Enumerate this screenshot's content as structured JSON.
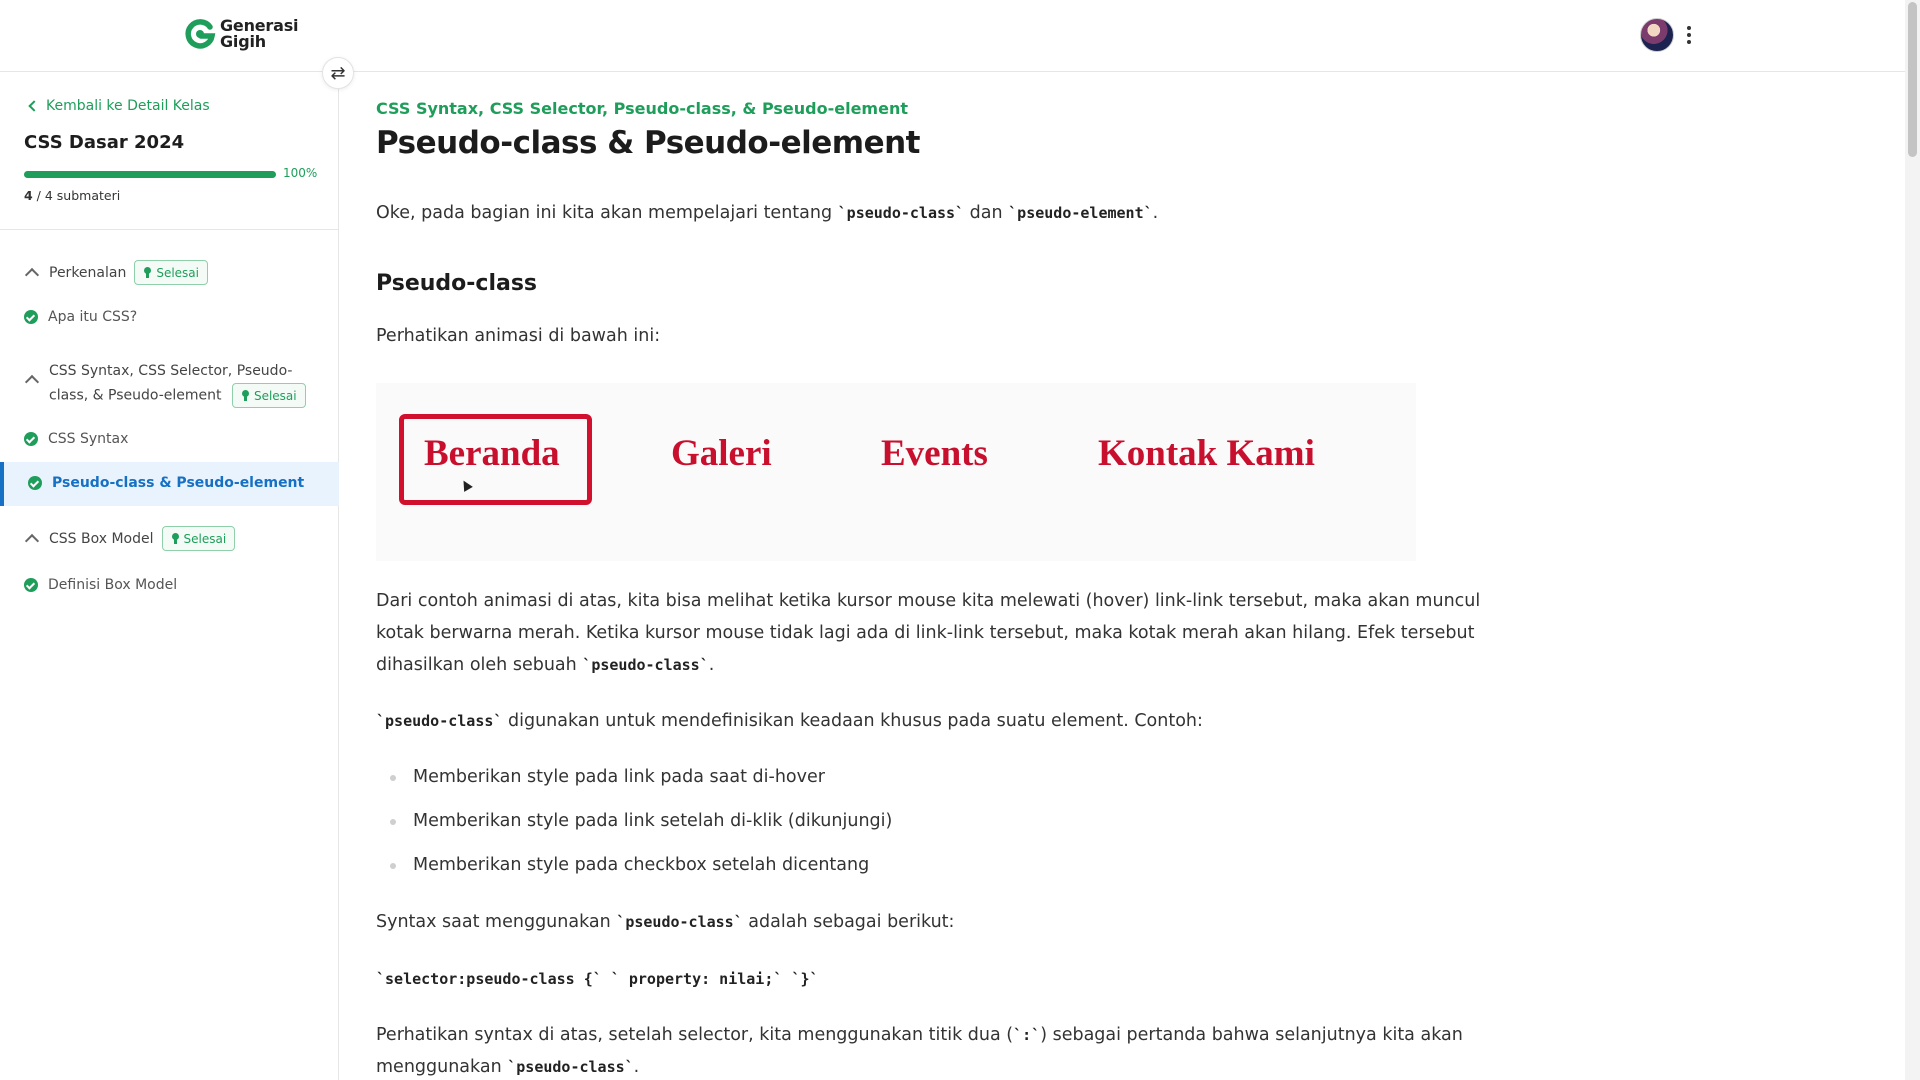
{
  "header": {
    "brand_line1": "Generasi",
    "brand_line2": "Gigih"
  },
  "colors": {
    "accent_green": "#1e9e5a",
    "active_blue": "#1670c4",
    "demo_red": "#c8102e"
  },
  "sidebar": {
    "back_label": "Kembali ke Detail Kelas",
    "course_title": "CSS Dasar 2024",
    "progress_percent": 100,
    "progress_label": "100%",
    "completed": "4",
    "total_label": " / 4 submateri",
    "sections": [
      {
        "label": "Perkenalan",
        "badge": "Selesai",
        "lessons": [
          "Apa itu CSS?"
        ]
      },
      {
        "label_line1": "CSS Syntax, CSS Selector, Pseudo-",
        "label_line2": "class, & Pseudo-element",
        "badge": "Selesai",
        "lessons": [
          "CSS Syntax",
          "Pseudo-class & Pseudo-element"
        ]
      },
      {
        "label": "CSS Box Model",
        "badge": "Selesai",
        "lessons": [
          "Definisi Box Model"
        ]
      }
    ]
  },
  "main": {
    "kicker": "CSS Syntax, CSS Selector, Pseudo-class, & Pseudo-element",
    "title": "Pseudo-class & Pseudo-element",
    "intro_a": "Oke, pada bagian ini kita akan mempelajari tentang ",
    "intro_code1": "`pseudo-class`",
    "intro_b": " dan ",
    "intro_code2": "`pseudo-element`",
    "intro_c": ".",
    "heading_pseudo_class": "Pseudo-class",
    "look_animation": "Perhatikan animasi di bawah ini:",
    "demo_links": [
      "Beranda",
      "Galeri",
      "Events",
      "Kontak Kami"
    ],
    "para1_line1": "Dari contoh animasi di atas, kita bisa melihat ketika kursor mouse kita melewati (hover) link-link tersebut, maka akan muncul",
    "para1_line2": "kotak berwarna merah. Ketika kursor mouse tidak lagi ada di link-link tersebut, maka kotak merah akan hilang. Efek tersebut",
    "para1_line3a": "dihasilkan oleh sebuah ",
    "para1_code": "`pseudo-class`",
    "para1_line3b": ".",
    "para2_code": "`pseudo-class`",
    "para2_text": " digunakan untuk mendefinisikan keadaan khusus pada suatu element. Contoh:",
    "bullets": [
      "Memberikan style pada link pada saat di-hover",
      "Memberikan style pada link setelah di-klik (dikunjungi)",
      "Memberikan style pada checkbox setelah dicentang"
    ],
    "syntax_a": "Syntax saat menggunakan ",
    "syntax_code": "`pseudo-class`",
    "syntax_b": " adalah sebagai berikut:",
    "syntax_example": "`selector:pseudo-class {` ` property: nilai;` `}`",
    "para3_line1a": "Perhatikan syntax di atas, setelah selector, kita menggunakan titik dua (",
    "para3_code1": "`:`",
    "para3_line1b": ") sebagai pertanda bahwa selanjutnya kita akan",
    "para3_line2a": "menggunakan ",
    "para3_code2": "`pseudo-class`",
    "para3_line2b": "."
  }
}
